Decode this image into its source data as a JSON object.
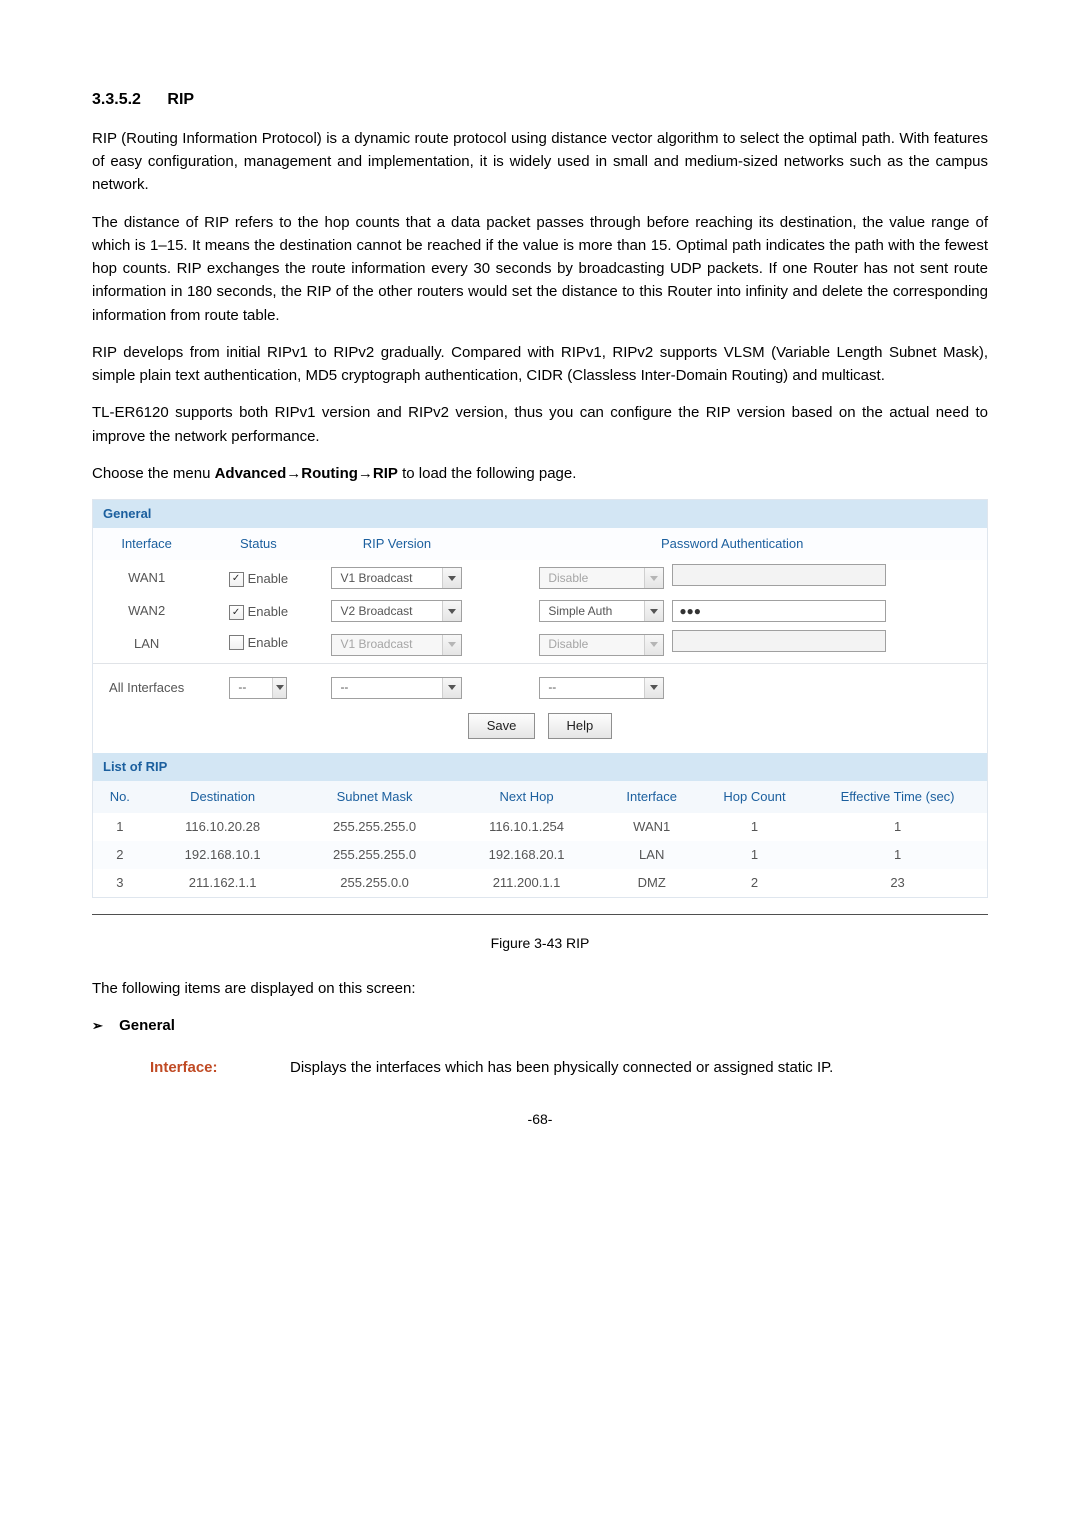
{
  "heading": {
    "number": "3.3.5.2",
    "title": "RIP"
  },
  "paragraphs": {
    "p1": "RIP (Routing Information Protocol) is a dynamic route protocol using distance vector algorithm to select the optimal path. With features of easy configuration, management and implementation, it is widely used in small and medium-sized networks such as the campus network.",
    "p2": "The distance of RIP refers to the hop counts that a data packet passes through before reaching its destination, the value range of which is 1–15. It means the destination cannot be reached if the value is more than 15. Optimal path indicates the path with the fewest hop counts. RIP exchanges the route information every 30 seconds by broadcasting UDP packets. If one Router has not sent route information in 180 seconds, the RIP of the other routers would set the distance to this Router into infinity and delete the corresponding information from route table.",
    "p3": "RIP develops from initial RIPv1 to RIPv2 gradually. Compared with RIPv1, RIPv2 supports VLSM (Variable Length Subnet Mask), simple plain text authentication, MD5 cryptograph authentication, CIDR (Classless Inter-Domain Routing) and multicast.",
    "p4": "TL-ER6120 supports both RIPv1 version and RIPv2 version, thus you can configure the RIP version based on the actual need to improve the network performance.",
    "menuPrefix": "Choose the menu ",
    "menuBold": "Advanced→Routing→RIP",
    "menuSuffix": " to load the following page."
  },
  "generalPanel": {
    "title": "General",
    "columns": {
      "interface": "Interface",
      "status": "Status",
      "rip": "RIP Version",
      "auth": "Password Authentication"
    },
    "rows": [
      {
        "interface": "WAN1",
        "enabled": true,
        "statusLabel": "Enable",
        "rip": "V1 Broadcast",
        "ripDisabled": false,
        "auth": "Disable",
        "authDisabled": true,
        "pw": "",
        "pwDisabled": true
      },
      {
        "interface": "WAN2",
        "enabled": true,
        "statusLabel": "Enable",
        "rip": "V2 Broadcast",
        "ripDisabled": false,
        "auth": "Simple Auth",
        "authDisabled": false,
        "pw": "●●●",
        "pwDisabled": false
      },
      {
        "interface": "LAN",
        "enabled": false,
        "statusLabel": "Enable",
        "rip": "V1 Broadcast",
        "ripDisabled": true,
        "auth": "Disable",
        "authDisabled": true,
        "pw": "",
        "pwDisabled": true
      }
    ],
    "allRow": {
      "label": "All Interfaces",
      "status": "--",
      "rip": "--",
      "auth": "--"
    },
    "buttons": {
      "save": "Save",
      "help": "Help"
    }
  },
  "listPanel": {
    "title": "List of RIP",
    "columns": {
      "no": "No.",
      "dest": "Destination",
      "mask": "Subnet Mask",
      "next": "Next Hop",
      "iface": "Interface",
      "hop": "Hop Count",
      "eff": "Effective Time (sec)"
    },
    "rows": [
      {
        "no": "1",
        "dest": "116.10.20.28",
        "mask": "255.255.255.0",
        "next": "116.10.1.254",
        "iface": "WAN1",
        "hop": "1",
        "eff": "1"
      },
      {
        "no": "2",
        "dest": "192.168.10.1",
        "mask": "255.255.255.0",
        "next": "192.168.20.1",
        "iface": "LAN",
        "hop": "1",
        "eff": "1"
      },
      {
        "no": "3",
        "dest": "211.162.1.1",
        "mask": "255.255.0.0",
        "next": "211.200.1.1",
        "iface": "DMZ",
        "hop": "2",
        "eff": "23"
      }
    ]
  },
  "figureCaption": "Figure 3-43 RIP",
  "itemsLine": "The following items are displayed on this screen:",
  "generalSection": {
    "title": "General",
    "field": {
      "label": "Interface:",
      "desc": "Displays the interfaces which has been physically connected or assigned static IP."
    }
  },
  "pageNumber": "-68-"
}
